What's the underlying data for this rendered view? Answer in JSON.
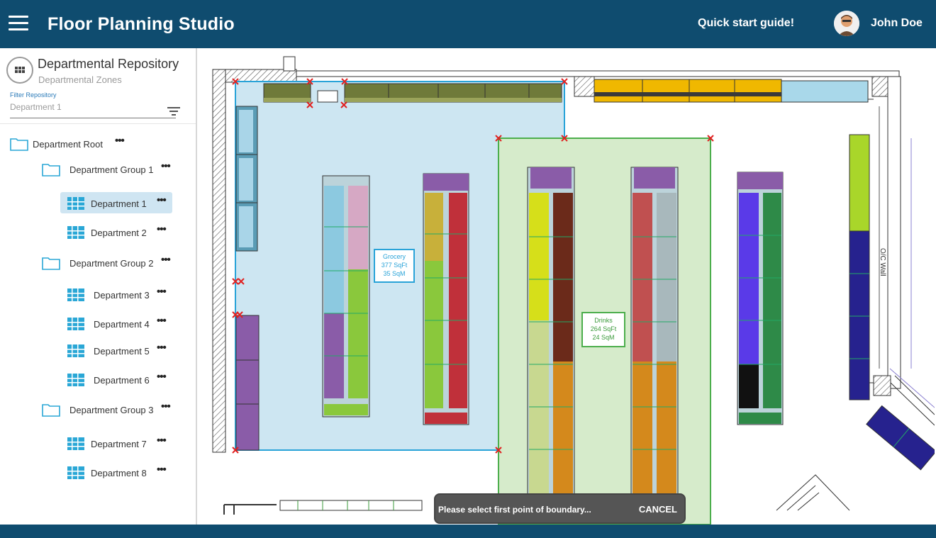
{
  "header": {
    "app_title": "Floor Planning Studio",
    "quick_start": "Quick start guide!",
    "user_name": "John Doe"
  },
  "repository": {
    "title": "Departmental Repository",
    "subtitle": "Departmental Zones",
    "filter_label": "Filter Repository",
    "filter_value": "Department 1"
  },
  "tree": {
    "root": "Department Root",
    "group1": "Department Group 1",
    "dept1": "Department 1",
    "dept2": "Department 2",
    "group2": "Department Group 2",
    "dept3": "Department 3",
    "dept4": "Department 4",
    "dept5": "Department 5",
    "dept6": "Department 6",
    "group3": "Department Group 3",
    "dept7": "Department 7",
    "dept8": "Department 8",
    "more": "•••"
  },
  "zones": {
    "grocery": {
      "name": "Grocery",
      "sqft": "377 SqFt",
      "sqm": "35 SqM"
    },
    "drinks": {
      "name": "Drinks",
      "sqft": "264 SqFt",
      "sqm": "24 SqM"
    }
  },
  "wall_label": "O/C Wall",
  "toast": {
    "message": "Please select first point of boundary...",
    "cancel": "CANCEL"
  },
  "colors": {
    "topbar": "#0f4c6f",
    "selected_item": "#cfe5f2",
    "grocery_zone": "#cde6f2",
    "drinks_zone": "#d6ebcb",
    "marker": "#e02020"
  }
}
